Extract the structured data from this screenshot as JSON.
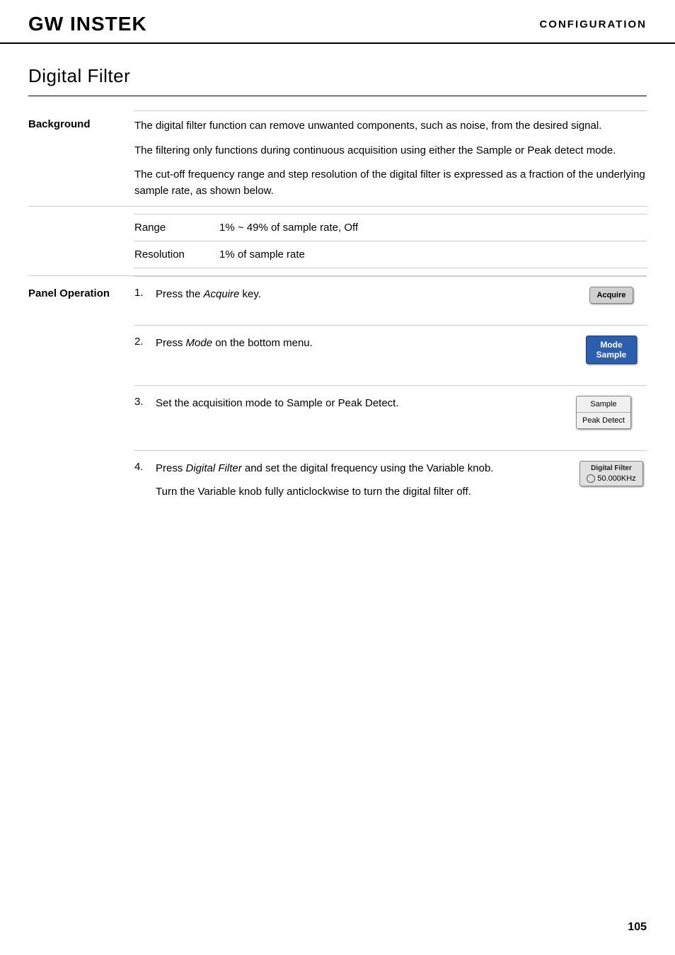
{
  "header": {
    "logo": "GW INSTEK",
    "logo_gw": "GW",
    "logo_instek": "INSTEK",
    "title": "CONFIGURATION"
  },
  "section": {
    "title": "Digital Filter"
  },
  "background": {
    "label": "Background",
    "paragraphs": [
      "The digital filter function can remove unwanted components, such as noise, from the desired signal.",
      "The filtering only functions during continuous acquisition using either the Sample or Peak detect mode.",
      "The cut-off frequency range and step resolution of the digital filter is expressed as a fraction of the underlying sample rate, as shown below."
    ],
    "range_label": "Range",
    "range_value": "1% ~ 49% of sample rate, Off",
    "resolution_label": "Resolution",
    "resolution_value": "1% of sample rate"
  },
  "panel_operation": {
    "label": "Panel Operation",
    "steps": [
      {
        "number": "1.",
        "text": "Press the Acquire key.",
        "key_word": "Acquire",
        "button_label": "Acquire"
      },
      {
        "number": "2.",
        "text": "Press Mode on the bottom menu.",
        "key_word": "Mode",
        "button_top": "Mode",
        "button_bottom": "Sample"
      },
      {
        "number": "3.",
        "text": "Set the acquisition mode to Sample or Peak Detect.",
        "button_sample": "Sample",
        "button_peak": "Peak Detect"
      },
      {
        "number": "4.",
        "text_line1": "Press Digital Filter and set the digital frequency using the Variable knob.",
        "text_line2": "Turn the Variable knob fully anticlockwise to turn the digital filter off.",
        "key_word": "Digital Filter",
        "filter_label": "Digital Filter",
        "filter_freq": "50.000KHz"
      }
    ]
  },
  "page_number": "105"
}
